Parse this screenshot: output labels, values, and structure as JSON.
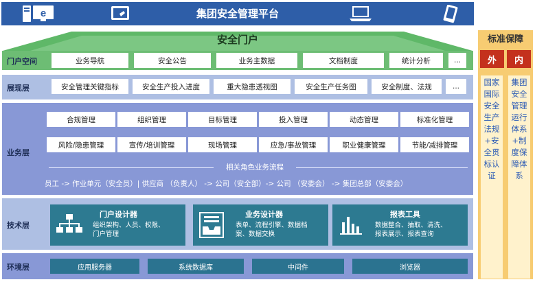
{
  "header": {
    "title": "集团安全管理平台",
    "icons": [
      "monitor-ie-icon",
      "tablet-icon",
      "laptop-icon",
      "phone-icon"
    ]
  },
  "portal": {
    "title": "安全门户"
  },
  "layers": {
    "portal_space": {
      "label": "门户空间",
      "items": [
        "业务导航",
        "安全公告",
        "业务主数据",
        "文档制度",
        "统计分析",
        "..."
      ]
    },
    "display": {
      "label": "展现层",
      "items": [
        "安全管理关键指标",
        "安全生产投入进度",
        "重大隐患透视图",
        "安全生产任务图",
        "安全制度、法规",
        "..."
      ]
    },
    "business": {
      "label": "业务层",
      "row1": [
        "合规管理",
        "组织管理",
        "目标管理",
        "投入管理",
        "动态管理",
        "标准化管理"
      ],
      "row2": [
        "风险/隐患管理",
        "宣传/培训管理",
        "现场管理",
        "应急/事故管理",
        "职业健康管理",
        "节能/减排管理"
      ],
      "flow_title": "相关角色业务流程",
      "flow_text": "员工 -> 作业单元（安全员）| 供应商 （负责人） -> 公司（安全部）-> 公司 （安委会） -> 集团总部（安委会）"
    },
    "tech": {
      "label": "技术层",
      "cards": [
        {
          "title": "门户设计器",
          "desc": [
            "组织架构、人员、权限、",
            "门户管理"
          ],
          "icon": "org-chart-icon"
        },
        {
          "title": "业务设计器",
          "desc": [
            "表单、流程引擎、数据档",
            "案、数据交换"
          ],
          "icon": "inbox-tray-icon"
        },
        {
          "title": "报表工具",
          "desc": [
            "数据整合、抽取、清洗、",
            "报表展示、报表查询"
          ],
          "icon": "bar-chart-icon"
        }
      ]
    },
    "env": {
      "label": "环境层",
      "items": [
        "应用服务器",
        "系统数据库",
        "中间件",
        "浏览器"
      ]
    }
  },
  "standards": {
    "title": "标准保障",
    "outer_label": "外",
    "inner_label": "内",
    "outer_text": "国家国际安全生产法规+安全贯标认证",
    "inner_text": "集团安全管理运行体系+制度保障体系"
  },
  "colors": {
    "banner": "#2e5ea8",
    "portal_green": "#6dbd74",
    "business_blue": "#8898d6",
    "display_blue": "#aebfe3",
    "tech_card": "#2d7a91",
    "standards_bg": "#f7cc72",
    "standards_tab": "#c4311d",
    "standards_text": "#2a59b5"
  }
}
